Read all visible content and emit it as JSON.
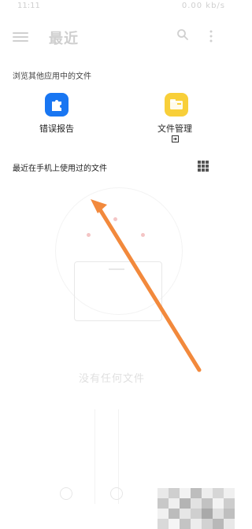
{
  "status_bar": {
    "time": "11:11",
    "indicators": "0.00 kb/s"
  },
  "app_bar": {
    "title": "最近",
    "icons": [
      "menu-icon",
      "search-icon",
      "more-vertical-icon"
    ]
  },
  "browse_section": {
    "title": "浏览其他应用中的文件",
    "apps": [
      {
        "label": "错误报告",
        "icon": "puzzle-icon",
        "color": "#1976f2"
      },
      {
        "label": "文件管理",
        "icon": "folder-icon",
        "color": "#f8cf39"
      }
    ]
  },
  "recent_section": {
    "title": "最近在手机上使用过的文件",
    "view_icon": "grid-view-icon"
  },
  "empty_state": {
    "text": "没有任何文件"
  },
  "bottom_nav": {
    "icons": [
      "home-icon",
      "files-icon"
    ]
  },
  "annotation": {
    "type": "arrow",
    "color": "#f2893c"
  }
}
